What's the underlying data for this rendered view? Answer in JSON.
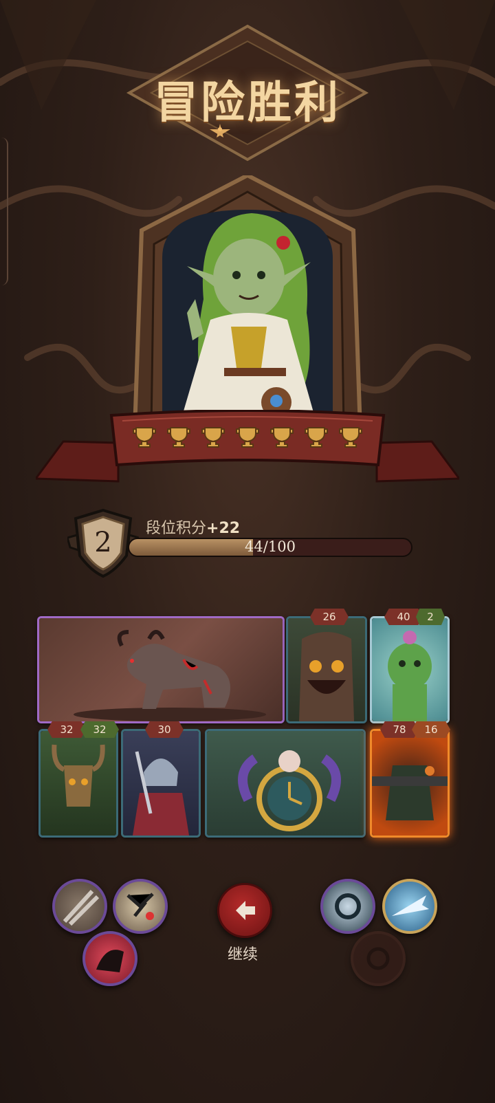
{
  "title": "冒险胜利",
  "hero": {
    "trophy_count": 7
  },
  "rank": {
    "level": "2",
    "label": "段位积分",
    "gain": "+22",
    "progress_text": "44/100",
    "progress_fraction": 0.44
  },
  "cards": {
    "card1": {
      "name_icon": "wildebeest-beast-card"
    },
    "card2": {
      "stat": "26"
    },
    "card3": {
      "stat": "40",
      "stat2": "2"
    },
    "card4": {
      "stat": "32",
      "stat2": "32"
    },
    "card5": {
      "stat": "30"
    },
    "card6": {
      "name_icon": "clock-bunny-card"
    },
    "card7": {
      "stat": "78",
      "stat2": "16"
    }
  },
  "actions": {
    "continue_label": "继续"
  },
  "icons": {
    "skill1": "swords-icon",
    "skill2": "scroll-burst-icon",
    "skill3": "shadow-beast-icon",
    "skill4": "vortex-icon",
    "skill5": "ice-blade-icon",
    "skill6": "sun-sigil-icon"
  },
  "colors": {
    "accent": "#f3d6a2",
    "ribbon": "#7a2b24",
    "continue": "#a82424"
  }
}
